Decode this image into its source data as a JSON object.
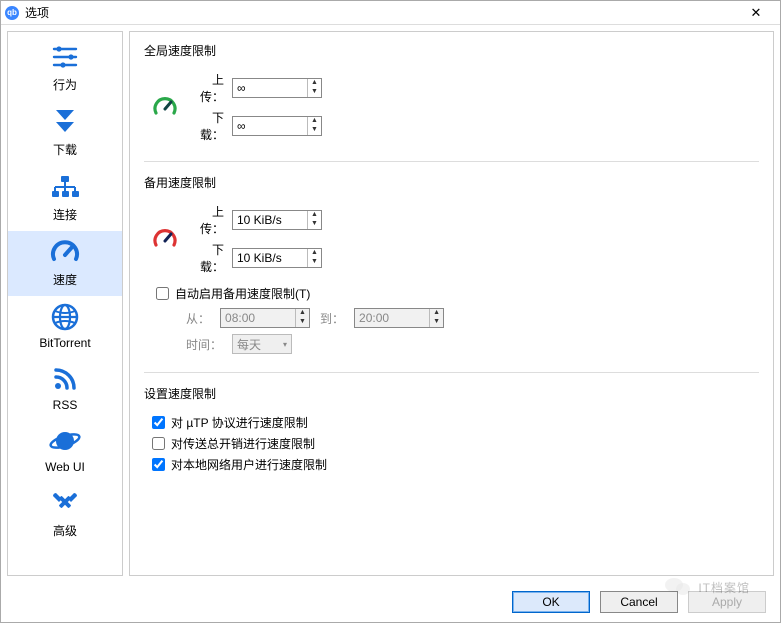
{
  "window": {
    "title": "选项"
  },
  "sidebar": {
    "items": [
      {
        "label": "行为"
      },
      {
        "label": "下载"
      },
      {
        "label": "连接"
      },
      {
        "label": "速度"
      },
      {
        "label": "BitTorrent"
      },
      {
        "label": "RSS"
      },
      {
        "label": "Web UI"
      },
      {
        "label": "高级"
      }
    ]
  },
  "groups": {
    "global": {
      "title": "全局速度限制",
      "upload_label": "上传：",
      "download_label": "下载：",
      "upload_value": "∞",
      "download_value": "∞"
    },
    "alt": {
      "title": "备用速度限制",
      "upload_label": "上传：",
      "download_label": "下载：",
      "upload_value": "10 KiB/s",
      "download_value": "10 KiB/s",
      "schedule_label": "自动启用备用速度限制(T)",
      "from_label": "从：",
      "from_value": "08:00",
      "to_label": "到：",
      "to_value": "20:00",
      "period_label": "时间：",
      "period_value": "每天"
    },
    "settings": {
      "title": "设置速度限制",
      "rows": [
        {
          "label": "对 µTP 协议进行速度限制",
          "checked": true
        },
        {
          "label": "对传送总开销进行速度限制",
          "checked": false
        },
        {
          "label": "对本地网络用户进行速度限制",
          "checked": true
        }
      ]
    }
  },
  "buttons": {
    "ok": "OK",
    "cancel": "Cancel",
    "apply": "Apply"
  },
  "watermark": "IT档案馆"
}
